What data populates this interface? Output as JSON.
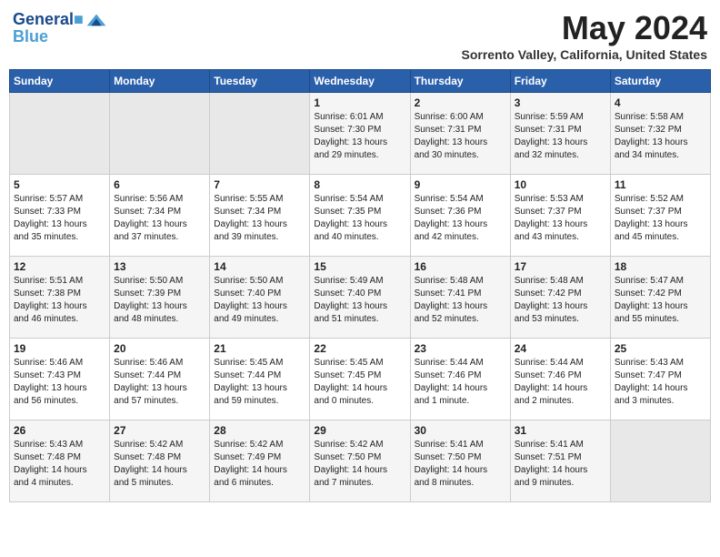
{
  "header": {
    "logo_line1": "General",
    "logo_line2": "Blue",
    "month_year": "May 2024",
    "location": "Sorrento Valley, California, United States"
  },
  "weekdays": [
    "Sunday",
    "Monday",
    "Tuesday",
    "Wednesday",
    "Thursday",
    "Friday",
    "Saturday"
  ],
  "weeks": [
    [
      {
        "day": "",
        "info": ""
      },
      {
        "day": "",
        "info": ""
      },
      {
        "day": "",
        "info": ""
      },
      {
        "day": "1",
        "info": "Sunrise: 6:01 AM\nSunset: 7:30 PM\nDaylight: 13 hours\nand 29 minutes."
      },
      {
        "day": "2",
        "info": "Sunrise: 6:00 AM\nSunset: 7:31 PM\nDaylight: 13 hours\nand 30 minutes."
      },
      {
        "day": "3",
        "info": "Sunrise: 5:59 AM\nSunset: 7:31 PM\nDaylight: 13 hours\nand 32 minutes."
      },
      {
        "day": "4",
        "info": "Sunrise: 5:58 AM\nSunset: 7:32 PM\nDaylight: 13 hours\nand 34 minutes."
      }
    ],
    [
      {
        "day": "5",
        "info": "Sunrise: 5:57 AM\nSunset: 7:33 PM\nDaylight: 13 hours\nand 35 minutes."
      },
      {
        "day": "6",
        "info": "Sunrise: 5:56 AM\nSunset: 7:34 PM\nDaylight: 13 hours\nand 37 minutes."
      },
      {
        "day": "7",
        "info": "Sunrise: 5:55 AM\nSunset: 7:34 PM\nDaylight: 13 hours\nand 39 minutes."
      },
      {
        "day": "8",
        "info": "Sunrise: 5:54 AM\nSunset: 7:35 PM\nDaylight: 13 hours\nand 40 minutes."
      },
      {
        "day": "9",
        "info": "Sunrise: 5:54 AM\nSunset: 7:36 PM\nDaylight: 13 hours\nand 42 minutes."
      },
      {
        "day": "10",
        "info": "Sunrise: 5:53 AM\nSunset: 7:37 PM\nDaylight: 13 hours\nand 43 minutes."
      },
      {
        "day": "11",
        "info": "Sunrise: 5:52 AM\nSunset: 7:37 PM\nDaylight: 13 hours\nand 45 minutes."
      }
    ],
    [
      {
        "day": "12",
        "info": "Sunrise: 5:51 AM\nSunset: 7:38 PM\nDaylight: 13 hours\nand 46 minutes."
      },
      {
        "day": "13",
        "info": "Sunrise: 5:50 AM\nSunset: 7:39 PM\nDaylight: 13 hours\nand 48 minutes."
      },
      {
        "day": "14",
        "info": "Sunrise: 5:50 AM\nSunset: 7:40 PM\nDaylight: 13 hours\nand 49 minutes."
      },
      {
        "day": "15",
        "info": "Sunrise: 5:49 AM\nSunset: 7:40 PM\nDaylight: 13 hours\nand 51 minutes."
      },
      {
        "day": "16",
        "info": "Sunrise: 5:48 AM\nSunset: 7:41 PM\nDaylight: 13 hours\nand 52 minutes."
      },
      {
        "day": "17",
        "info": "Sunrise: 5:48 AM\nSunset: 7:42 PM\nDaylight: 13 hours\nand 53 minutes."
      },
      {
        "day": "18",
        "info": "Sunrise: 5:47 AM\nSunset: 7:42 PM\nDaylight: 13 hours\nand 55 minutes."
      }
    ],
    [
      {
        "day": "19",
        "info": "Sunrise: 5:46 AM\nSunset: 7:43 PM\nDaylight: 13 hours\nand 56 minutes."
      },
      {
        "day": "20",
        "info": "Sunrise: 5:46 AM\nSunset: 7:44 PM\nDaylight: 13 hours\nand 57 minutes."
      },
      {
        "day": "21",
        "info": "Sunrise: 5:45 AM\nSunset: 7:44 PM\nDaylight: 13 hours\nand 59 minutes."
      },
      {
        "day": "22",
        "info": "Sunrise: 5:45 AM\nSunset: 7:45 PM\nDaylight: 14 hours\nand 0 minutes."
      },
      {
        "day": "23",
        "info": "Sunrise: 5:44 AM\nSunset: 7:46 PM\nDaylight: 14 hours\nand 1 minute."
      },
      {
        "day": "24",
        "info": "Sunrise: 5:44 AM\nSunset: 7:46 PM\nDaylight: 14 hours\nand 2 minutes."
      },
      {
        "day": "25",
        "info": "Sunrise: 5:43 AM\nSunset: 7:47 PM\nDaylight: 14 hours\nand 3 minutes."
      }
    ],
    [
      {
        "day": "26",
        "info": "Sunrise: 5:43 AM\nSunset: 7:48 PM\nDaylight: 14 hours\nand 4 minutes."
      },
      {
        "day": "27",
        "info": "Sunrise: 5:42 AM\nSunset: 7:48 PM\nDaylight: 14 hours\nand 5 minutes."
      },
      {
        "day": "28",
        "info": "Sunrise: 5:42 AM\nSunset: 7:49 PM\nDaylight: 14 hours\nand 6 minutes."
      },
      {
        "day": "29",
        "info": "Sunrise: 5:42 AM\nSunset: 7:50 PM\nDaylight: 14 hours\nand 7 minutes."
      },
      {
        "day": "30",
        "info": "Sunrise: 5:41 AM\nSunset: 7:50 PM\nDaylight: 14 hours\nand 8 minutes."
      },
      {
        "day": "31",
        "info": "Sunrise: 5:41 AM\nSunset: 7:51 PM\nDaylight: 14 hours\nand 9 minutes."
      },
      {
        "day": "",
        "info": ""
      }
    ]
  ]
}
